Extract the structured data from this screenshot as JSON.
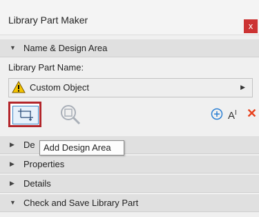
{
  "window": {
    "title": "Library Part Maker",
    "close_glyph": "x"
  },
  "sections": {
    "name_design": "Name & Design Area",
    "design_partial": "De",
    "properties": "Properties",
    "details": "Details",
    "check_save": "Check and Save Library Part"
  },
  "library_part": {
    "label": "Library Part Name:",
    "value": "Custom Object"
  },
  "toolbar": {
    "text_glyph": "A",
    "text_superscript": "I",
    "delete_glyph": "✕"
  },
  "tooltip": {
    "text": "Add Design Area"
  },
  "colors": {
    "highlight_border": "#b3262b",
    "close_bg": "#cc3333",
    "accent_blue": "#2a7fd4",
    "delete_red": "#e8401c"
  },
  "icons": [
    "design-area-icon",
    "zoom-icon",
    "add-icon",
    "text-size-icon",
    "delete-icon",
    "warning-icon"
  ]
}
